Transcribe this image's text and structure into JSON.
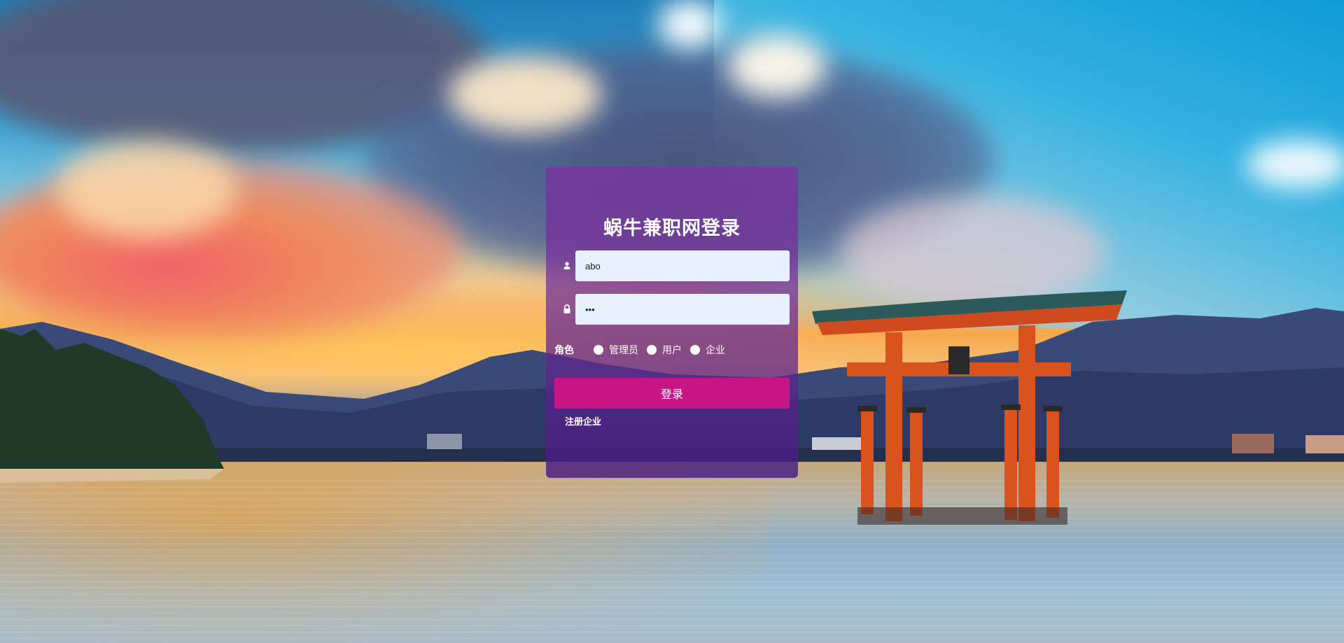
{
  "login": {
    "title": "蜗牛兼职网登录",
    "username": {
      "value": "abo",
      "icon": "user-icon"
    },
    "password": {
      "value": "•••",
      "icon": "lock-icon"
    },
    "role": {
      "label": "角色",
      "options": [
        "管理员",
        "用户",
        "企业"
      ]
    },
    "submit_label": "登录",
    "register_label": "注册企业"
  },
  "background": {
    "scene": "torii gate over water at sunset"
  },
  "colors": {
    "card": "#7a34a0",
    "button": "#c71585",
    "input": "#e8f0fe"
  }
}
